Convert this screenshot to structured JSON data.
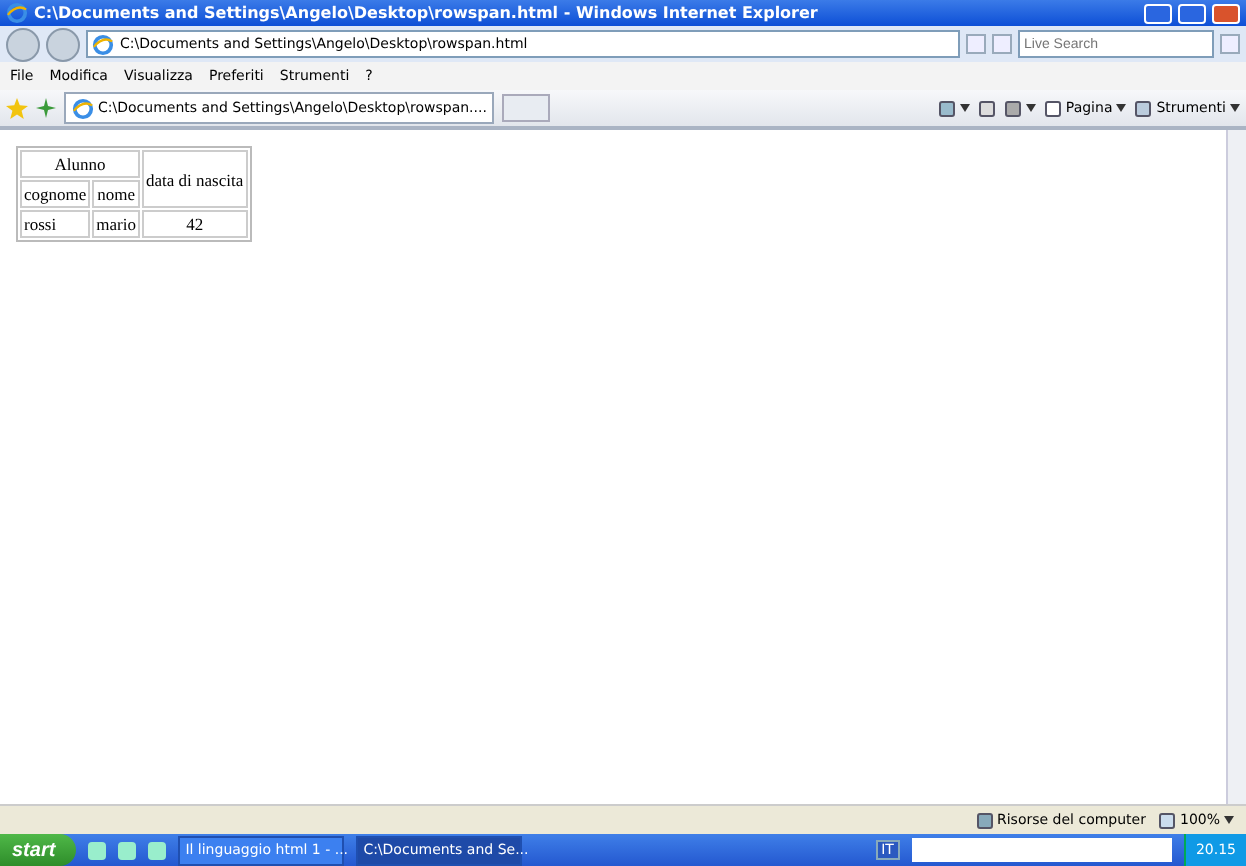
{
  "window": {
    "title": "C:\\Documents and Settings\\Angelo\\Desktop\\rowspan.html - Windows Internet Explorer"
  },
  "address_bar": {
    "value": "C:\\Documents and Settings\\Angelo\\Desktop\\rowspan.html"
  },
  "search": {
    "placeholder": "Live Search"
  },
  "menu": [
    "File",
    "Modifica",
    "Visualizza",
    "Preferiti",
    "Strumenti",
    "?"
  ],
  "tabs": [
    {
      "label": "C:\\Documents and Settings\\Angelo\\Desktop\\rowspan....",
      "selected": true
    }
  ],
  "command_bar": {
    "page": "Pagina",
    "tools": "Strumenti"
  },
  "table": {
    "header": [
      [
        {
          "text": "Alunno",
          "colspan": 2
        },
        {
          "text": "data di nascita",
          "rowspan": 2
        }
      ],
      [
        {
          "text": "cognome"
        },
        {
          "text": "nome"
        }
      ]
    ],
    "rows": [
      [
        "rossi",
        "mario",
        "42"
      ]
    ]
  },
  "status_bar": {
    "zone": "Risorse del computer",
    "zoom": "100%"
  },
  "taskbar": {
    "start": "start",
    "buttons": [
      {
        "label": "Il linguaggio html 1 - ...",
        "selected": false
      },
      {
        "label": "C:\\Documents and Se...",
        "selected": true
      }
    ],
    "language": "IT",
    "clock": "20.15"
  }
}
